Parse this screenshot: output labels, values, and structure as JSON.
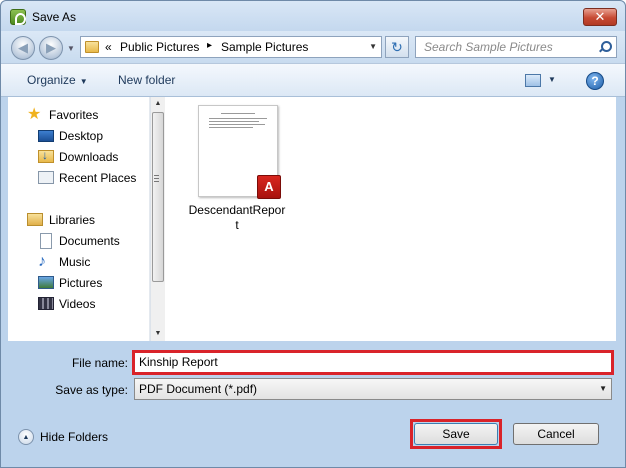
{
  "window": {
    "title": "Save As",
    "close_symbol": "✕"
  },
  "address_bar": {
    "back_symbol": "◀",
    "forward_symbol": "▶",
    "overflow_symbol": "«",
    "breadcrumbs": [
      "Public Pictures",
      "Sample Pictures"
    ],
    "separator": "▸",
    "refresh_symbol": "↻",
    "search_placeholder": "Search Sample Pictures"
  },
  "toolbar": {
    "organize_label": "Organize",
    "new_folder_label": "New folder",
    "help_symbol": "?"
  },
  "nav_pane": {
    "favorites_label": "Favorites",
    "favorites": [
      "Desktop",
      "Downloads",
      "Recent Places"
    ],
    "libraries_label": "Libraries",
    "libraries": [
      "Documents",
      "Music",
      "Pictures",
      "Videos"
    ]
  },
  "files": [
    {
      "name": "DescendantReport",
      "type_badge": "A"
    }
  ],
  "form": {
    "file_name_label": "File name:",
    "file_name_value": "Kinship Report",
    "save_type_label": "Save as type:",
    "save_type_value": "PDF Document (*.pdf)"
  },
  "footer": {
    "hide_folders_label": "Hide Folders",
    "save_label": "Save",
    "cancel_label": "Cancel"
  },
  "colors": {
    "highlight": "#d9232a",
    "window_frame": "#bcd3ec",
    "accent_link": "#1e395b"
  }
}
